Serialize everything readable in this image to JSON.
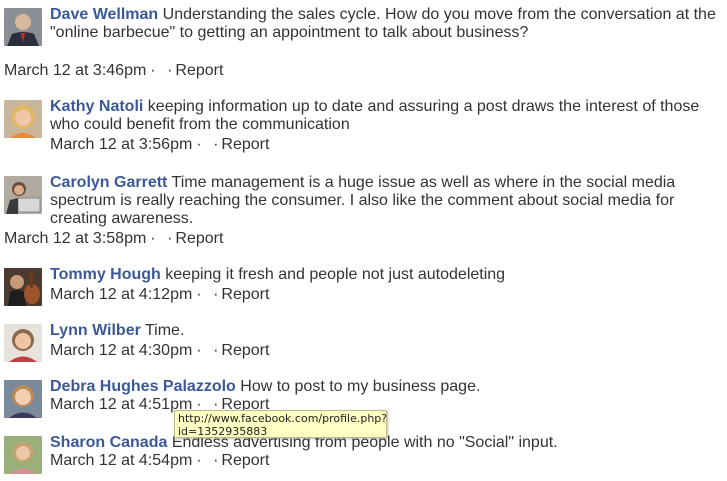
{
  "comments": [
    {
      "author": "Dave Wellman",
      "text": "Understanding the sales cycle. How do you move from the conversation at the \"online barbecue\" to getting an appointment to talk about business?",
      "timestamp": "March 12 at 3:46pm",
      "separator": "·",
      "report": "Report",
      "avatar": "man-in-suit-avatar"
    },
    {
      "author": "Kathy Natoli",
      "text": "keeping information up to date and assuring a post draws the interest of those who could benefit from the communication",
      "timestamp": "March 12 at 3:56pm",
      "separator": "·",
      "report": "Report",
      "avatar": "blonde-woman-avatar"
    },
    {
      "author": "Carolyn Garrett",
      "text": "Time management is a huge issue as well as where in the social media spectrum is really reaching the consumer. I also like the comment about social media for creating awareness.",
      "timestamp": "March 12 at 3:58pm",
      "separator": "·",
      "report": "Report",
      "avatar": "woman-with-laptop-avatar"
    },
    {
      "author": "Tommy Hough",
      "text": "keeping it fresh and people not just autodeleting",
      "timestamp": "March 12 at 4:12pm",
      "separator": "·",
      "report": "Report",
      "avatar": "man-with-guitar-avatar"
    },
    {
      "author": "Lynn Wilber",
      "text": "Time.",
      "timestamp": "March 12 at 4:30pm",
      "separator": "·",
      "report": "Report",
      "avatar": "woman-smiling-avatar"
    },
    {
      "author": "Debra Hughes Palazzolo",
      "text": "How to post to my business page.",
      "timestamp": "March 12 at 4:51pm",
      "separator": "·",
      "report": "Report",
      "avatar": "woman-portrait-avatar"
    },
    {
      "author": "Sharon Canada",
      "text": "Endless advertising from people with no \"Social\" input.",
      "timestamp": "March 12 at 4:54pm",
      "separator": "·",
      "report": "Report",
      "avatar": "woman-outdoors-avatar"
    }
  ],
  "tooltip": {
    "text": "http://www.facebook.com/profile.php?id=1352935883"
  },
  "colors": {
    "author_link": "#3b5998",
    "tooltip_bg": "#ffffc4"
  }
}
